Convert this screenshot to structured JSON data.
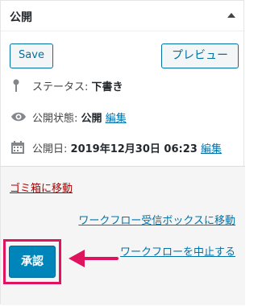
{
  "header": {
    "title": "公開"
  },
  "actions": {
    "save_label": "Save",
    "preview_label": "プレビュー"
  },
  "status": {
    "label": "ステータス:",
    "value": "下書き"
  },
  "visibility": {
    "label": "公開状態:",
    "value": "公開",
    "edit_label": "編集"
  },
  "publish_date": {
    "label": "公開日:",
    "value": "2019年12月30日 06:23",
    "edit_label": "編集"
  },
  "footer": {
    "trash_label": "ゴミ箱に移動",
    "workflow_inbox_label": "ワークフロー受信ボックスに移動",
    "workflow_stop_label": "ワークフローを中止する",
    "approve_label": "承認"
  },
  "colors": {
    "accent": "#0085ba",
    "link": "#0073aa",
    "trash": "#a00000",
    "highlight": "#e0135f"
  },
  "icons": [
    "collapse-caret-icon",
    "pin-icon",
    "eye-icon",
    "calendar-icon",
    "pointing-arrow-icon"
  ]
}
